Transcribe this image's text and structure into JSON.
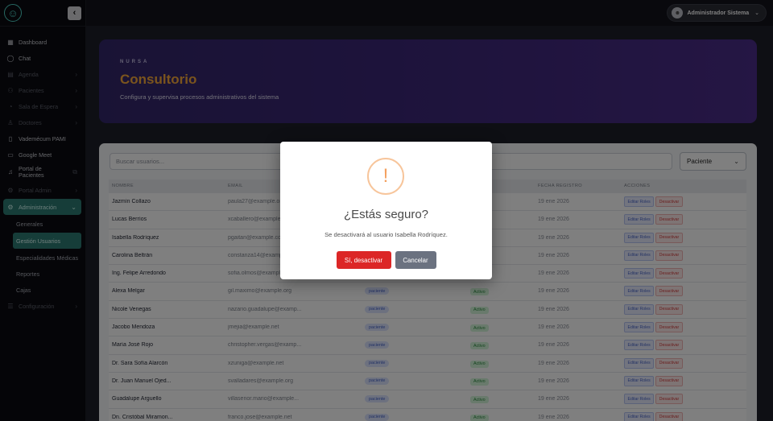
{
  "topbar": {
    "user_name": "Administrador Sistema",
    "chevron": "⌄"
  },
  "sidebar": {
    "items": [
      {
        "label": "Dashboard",
        "icon": "▦",
        "dim": false,
        "chev": false
      },
      {
        "label": "Chat",
        "icon": "◯",
        "dim": false,
        "chev": false
      },
      {
        "label": "Agenda",
        "icon": "▤",
        "dim": true,
        "chev": true
      },
      {
        "label": "Pacientes",
        "icon": "⚇",
        "dim": true,
        "chev": true
      },
      {
        "label": "Sala de Espera",
        "icon": "◔",
        "dim": true,
        "chev": true
      },
      {
        "label": "Doctores",
        "icon": "♙",
        "dim": true,
        "chev": true
      },
      {
        "label": "Vademécum PAMI",
        "icon": "▯",
        "dim": false,
        "chev": false
      },
      {
        "label": "Google Meet",
        "icon": "▭",
        "dim": false,
        "chev": false
      }
    ],
    "portal_pacientes": "Portal de Pacientes",
    "portal_admin": "Portal Admin",
    "administracion": "Administración",
    "sub_items": [
      "Generales",
      "Gestión Usuarios",
      "Especialidades Médicas",
      "Reportes",
      "Cajas"
    ],
    "configuracion": "Configuración"
  },
  "hero": {
    "brand": "NURSA",
    "title": "Consultorio",
    "subtitle": "Configura y supervisa procesos administrativos del sistema"
  },
  "search": {
    "placeholder": "Buscar usuarios..."
  },
  "filter": {
    "selected": "Paciente"
  },
  "table": {
    "headers": {
      "name": "NOMBRE",
      "email": "EMAIL",
      "date": "FECHA REGISTRO",
      "actions": "ACCIONES"
    },
    "edit_label": "Editar Roles",
    "deactivate_label": "Desactivar",
    "rows": [
      {
        "name": "Jazmín Collazo",
        "email": "paula27@example.org",
        "role": "",
        "status": "",
        "date": "19 ene 2026"
      },
      {
        "name": "Lucas Berríos",
        "email": "xcaballero@example.org",
        "role": "",
        "status": "",
        "date": "19 ene 2026"
      },
      {
        "name": "Isabella Rodríquez",
        "email": "pgaitan@example.com",
        "role": "",
        "status": "",
        "date": "19 ene 2026"
      },
      {
        "name": "Carolina Beltrán",
        "email": "constanza14@example.org",
        "role": "",
        "status": "",
        "date": "19 ene 2026"
      },
      {
        "name": "Ing. Felipe Arredondo",
        "email": "sofia.olmos@example.com",
        "role": "",
        "status": "",
        "date": "19 ene 2026"
      },
      {
        "name": "Alexa Melgar",
        "email": "gil.maximo@example.org",
        "role": "paciente",
        "status": "Activo",
        "date": "19 ene 2026"
      },
      {
        "name": "Nicole Venegas",
        "email": "nazario.guadalupe@examp...",
        "role": "paciente",
        "status": "Activo",
        "date": "19 ene 2026"
      },
      {
        "name": "Jacobo Mendoza",
        "email": "jmejia@example.net",
        "role": "paciente",
        "status": "Activo",
        "date": "19 ene 2026"
      },
      {
        "name": "María José Rojo",
        "email": "christopher.vergas@examp...",
        "role": "paciente",
        "status": "Activo",
        "date": "19 ene 2026"
      },
      {
        "name": "Dr. Sara Sofía Alarcón",
        "email": "xzuniga@example.net",
        "role": "paciente",
        "status": "Activo",
        "date": "19 ene 2026"
      },
      {
        "name": "Dr. Juan Manuel Ojed...",
        "email": "svalladares@example.org",
        "role": "paciente",
        "status": "Activo",
        "date": "19 ene 2026"
      },
      {
        "name": "Guadalupe Arguello",
        "email": "villasenor.mario@example...",
        "role": "paciente",
        "status": "Activo",
        "date": "19 ene 2026"
      },
      {
        "name": "Dn. Cristóbal Miramon...",
        "email": "franco.jose@example.net",
        "role": "paciente",
        "status": "Activo",
        "date": "19 ene 2026"
      }
    ]
  },
  "modal": {
    "icon": "!",
    "title": "¿Estás seguro?",
    "text": "Se desactivará al usuario Isabella Rodríquez.",
    "confirm_label": "Sí, desactivar",
    "cancel_label": "Cancelar"
  }
}
